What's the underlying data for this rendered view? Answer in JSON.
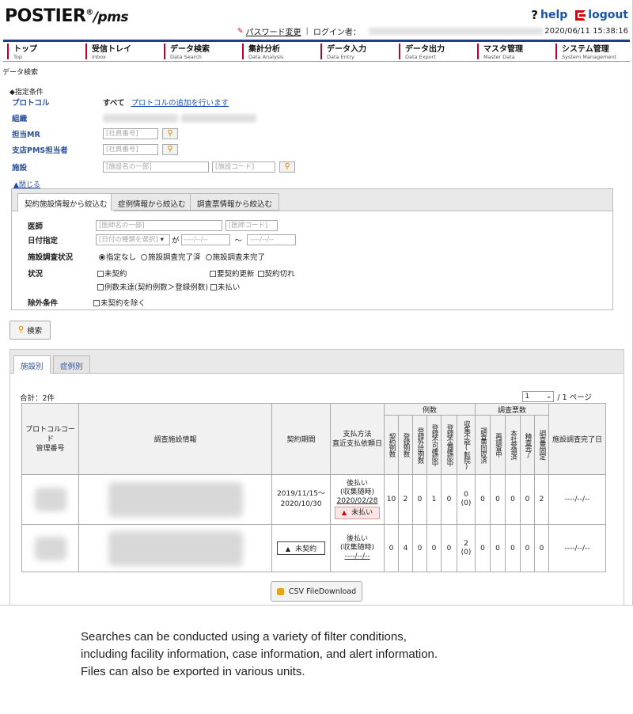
{
  "header": {
    "logo": "POSTIER",
    "logo_reg": "®",
    "logo_suffix": "/pms",
    "help": "help",
    "logout": "logout",
    "password_change": "パスワード変更",
    "login_user_label": "ログイン者：",
    "datetime": "2020/06/11 15:38:16"
  },
  "nav": [
    {
      "jp": "トップ",
      "en": "Top"
    },
    {
      "jp": "受信トレイ",
      "en": "Inbox"
    },
    {
      "jp": "データ検索",
      "en": "Data Search"
    },
    {
      "jp": "集計分析",
      "en": "Data Analysis"
    },
    {
      "jp": "データ入力",
      "en": "Data Entry"
    },
    {
      "jp": "データ出力",
      "en": "Data Export"
    },
    {
      "jp": "マスタ管理",
      "en": "Master Data"
    },
    {
      "jp": "システム管理",
      "en": "System Management"
    }
  ],
  "breadcrumb": "データ検索",
  "conditions": {
    "title": "◆指定条件",
    "protocol_label": "プロトコル",
    "protocol_value": "すべて",
    "protocol_add_link": "プロトコルの追加を行います",
    "org_label": "組織",
    "mr_label": "担当MR",
    "mr_placeholder": "[社員番号]",
    "branch_label": "支店PMS担当者",
    "branch_placeholder": "[社員番号]",
    "facility_label": "施設",
    "facility_name_placeholder": "[施設名の一部]",
    "facility_code_placeholder": "[施設コード]",
    "collapse_link": "▲閉じる"
  },
  "filter_tabs": [
    "契約施設情報から絞込む",
    "症例情報から絞込む",
    "調査票情報から絞込む"
  ],
  "filters": {
    "doctor_label": "医師",
    "doctor_name_placeholder": "[医師名の一部]",
    "doctor_code_placeholder": "[医師コード]",
    "date_label": "日付指定",
    "date_type_placeholder": "[日付の種類を選択]",
    "date_ga": "が",
    "date_from": "----/--/--",
    "date_tilde": "～",
    "date_to": "----/--/--",
    "survey_status_label": "施設調査状況",
    "survey_opt1": "指定なし",
    "survey_opt2": "施設調査完了済",
    "survey_opt3": "施設調査未完了",
    "status_label": "状況",
    "status_opt1": "未契約",
    "status_opt2": "要契約更新",
    "status_opt3": "契約切れ",
    "status_opt4": "例数未達(契約例数＞登録例数)",
    "status_opt5": "未払い",
    "exclude_label": "除外条件",
    "exclude_opt1": "未契約を除く"
  },
  "search_button": "検索",
  "results": {
    "tabs": [
      "施設別",
      "症例別"
    ],
    "total": "合計：2件",
    "page_current": "1",
    "page_suffix": "/ 1 ページ",
    "headers": {
      "protocol": "プロトコルコード\n管理番号",
      "facility": "調査施設情報",
      "period": "契約期間",
      "payment": "支払方法\n直近支払依頼日",
      "cases_group": "例数",
      "cases_cols": [
        "契約例数",
        "登録例数",
        "登録外症例数",
        "登録不可確認中",
        "登録不備確認中",
        "収集不能(転院)"
      ],
      "surveys_group": "調査票数",
      "survey_cols": [
        "調査票回収済",
        "再調査中",
        "本社受領済",
        "精査完了",
        "調査票固定"
      ],
      "completed": "施設調査完了日"
    },
    "rows": [
      {
        "period_start": "2019/11/15～",
        "period_end": "2020/10/30",
        "pay_method": "後払い",
        "pay_timing": "(収集随時)",
        "pay_date": "2020/02/28",
        "badge": "未払い",
        "cases": [
          "10",
          "2",
          "0",
          "1",
          "0",
          "0"
        ],
        "cases_sub": "(0)",
        "surveys": [
          "0",
          "0",
          "0",
          "0",
          "2"
        ],
        "completed": "----/--/--"
      },
      {
        "contract_badge": "未契約",
        "pay_method": "後払い",
        "pay_timing": "(収集随時)",
        "pay_date": "----/--/--",
        "cases": [
          "0",
          "4",
          "0",
          "0",
          "0",
          "2"
        ],
        "cases_sub": "(0)",
        "surveys": [
          "0",
          "0",
          "0",
          "0",
          "0"
        ],
        "completed": "----/--/--"
      }
    ],
    "csv_button": "CSV FileDownload"
  },
  "caption": [
    "Searches can be conducted using a variety of filter conditions,",
    "including facility information, case information, and alert information.",
    "Files can also be exported in various units."
  ]
}
